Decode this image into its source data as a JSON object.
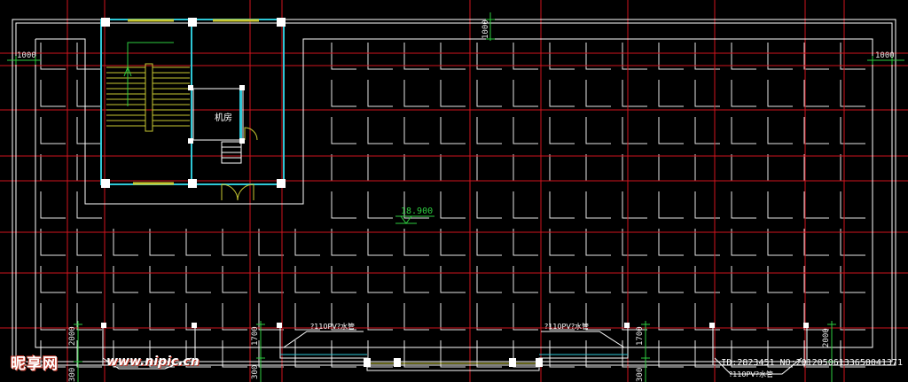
{
  "dimensions": {
    "top_1000": "1000",
    "left_1000": "1000",
    "right_1000": "1000",
    "bottom_left_2000": "2000",
    "bottom_mid_1700_a": "1700",
    "bottom_mid_1700_b": "1700",
    "bottom_right_2000": "2000",
    "bottom_300_a": "300",
    "bottom_300_b": "300",
    "bottom_300_c": "300"
  },
  "room_label": "机房",
  "elevation": "18.900",
  "pipe_labels": [
    "?110PV?水管",
    "?110PV?水管",
    "?110PV?水管"
  ],
  "watermark": {
    "brand": "昵享网",
    "url": "www.nipic.cn",
    "id": "ID:2823451 NO:20120506133650041371"
  },
  "colors": {
    "background": "#000000",
    "grid_axis": "#d0141e",
    "wall": "#ffffff",
    "column": "#ffffff",
    "stair": "#c8c832",
    "door": "#c8c832",
    "cyan": "#2ec7d6",
    "green": "#2ecc40"
  }
}
